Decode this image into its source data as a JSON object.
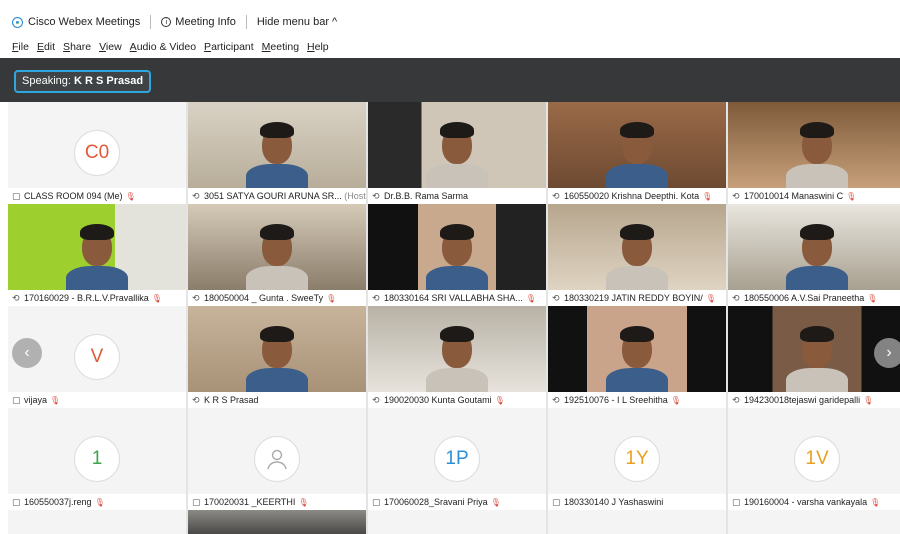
{
  "titlebar": {
    "app_name": "Cisco Webex Meetings",
    "meeting_info": "Meeting Info",
    "hide_menu": "Hide menu bar ^"
  },
  "menu": [
    "File",
    "Edit",
    "Share",
    "View",
    "Audio & Video",
    "Participant",
    "Meeting",
    "Help"
  ],
  "speaking": {
    "prefix": "Speaking:",
    "name": "K R S Prasad"
  },
  "participants": [
    {
      "name": "CLASS ROOM 094 (Me)",
      "type": "avatar",
      "initials": "C0",
      "color": "#e05a3a",
      "muted": true
    },
    {
      "name": "3051 SATYA GOURI ARUNA SR...",
      "host_tag": "(Host)",
      "type": "video",
      "muted": false
    },
    {
      "name": "Dr.B.B. Rama Sarma",
      "type": "video",
      "muted": false
    },
    {
      "name": "160550020 Krishna Deepthi. Kota",
      "type": "video",
      "muted": true
    },
    {
      "name": "170010014 Manaswini C",
      "type": "video",
      "muted": true
    },
    {
      "name": "170160029 - B.R.L.V.Pravallika",
      "type": "video",
      "muted": true
    },
    {
      "name": "180050004 _ Gunta . SweeTy",
      "type": "video",
      "muted": true
    },
    {
      "name": "180330164 SRI VALLABHA SHA...",
      "type": "video",
      "muted": true
    },
    {
      "name": "180330219 JATIN  REDDY BOYIN/",
      "type": "video",
      "muted": true
    },
    {
      "name": "180550006 A.V.Sai Praneetha",
      "type": "video",
      "muted": true
    },
    {
      "name": "vijaya",
      "type": "avatar",
      "initials": "V",
      "color": "#e05a3a",
      "muted": true
    },
    {
      "name": "K R S Prasad",
      "type": "video",
      "muted": false,
      "active": true
    },
    {
      "name": "190020030 Kunta Goutami",
      "type": "video",
      "muted": true
    },
    {
      "name": "192510076 - I L Sreehitha",
      "type": "video",
      "muted": true
    },
    {
      "name": "194230018tejaswi garidepalli",
      "type": "video",
      "muted": true
    },
    {
      "name": "160550037j.reng",
      "type": "avatar",
      "initials": "1",
      "color": "#3aa64a",
      "muted": true
    },
    {
      "name": "170020031 _KEERTHI",
      "type": "avatar",
      "initials": "",
      "color": "#aaaaaa",
      "muted": true
    },
    {
      "name": "170060028_Sravani Priya",
      "type": "avatar",
      "initials": "1P",
      "color": "#2d8fd6",
      "muted": true
    },
    {
      "name": "180330140 J Yashaswini",
      "type": "avatar",
      "initials": "1Y",
      "color": "#e8a020",
      "muted": false
    },
    {
      "name": "190160004 - varsha vankayala",
      "type": "avatar",
      "initials": "1V",
      "color": "#e8a020",
      "muted": true
    }
  ]
}
